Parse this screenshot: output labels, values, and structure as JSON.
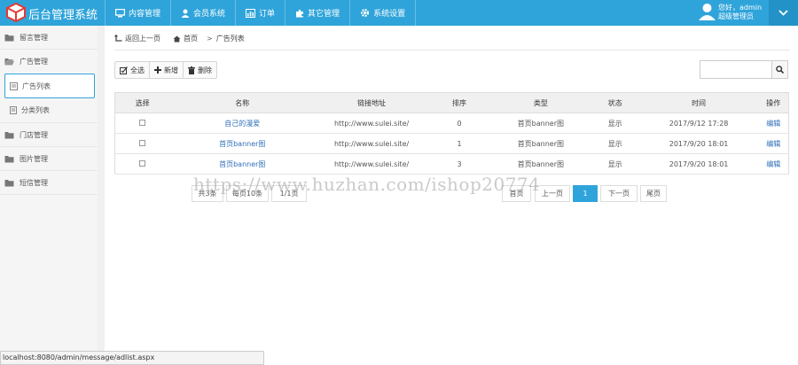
{
  "app": {
    "title": "后台管理系统"
  },
  "nav": [
    {
      "label": "内容管理",
      "icon": "monitor-icon"
    },
    {
      "label": "会员系统",
      "icon": "user-icon"
    },
    {
      "label": "订单",
      "icon": "chart-icon"
    },
    {
      "label": "其它管理",
      "icon": "puzzle-icon"
    },
    {
      "label": "系统设置",
      "icon": "gear-icon"
    }
  ],
  "user": {
    "greeting": "您好，admin",
    "role": "超级管理员"
  },
  "sidebar": {
    "groups": [
      {
        "label": "留言管理"
      },
      {
        "label": "广告管理"
      },
      {
        "label": "门店管理"
      },
      {
        "label": "图片管理"
      },
      {
        "label": "短信管理"
      }
    ],
    "subs": [
      {
        "label": "广告列表"
      },
      {
        "label": "分类列表"
      }
    ]
  },
  "breadcrumb": {
    "back": "返回上一页",
    "home": "首页",
    "sep": ">",
    "current": "广告列表"
  },
  "toolbar": {
    "select_all": "全选",
    "add": "新增",
    "delete": "删除"
  },
  "search": {
    "placeholder": ""
  },
  "table": {
    "headers": [
      "选择",
      "名称",
      "链接地址",
      "排序",
      "类型",
      "状态",
      "时间",
      "操作"
    ],
    "rows": [
      {
        "name": "自己的漫爱",
        "url": "http://www.sulei.site/",
        "sort": "0",
        "type": "首页banner图",
        "status": "显示",
        "time": "2017/9/12 17:28",
        "op": "编辑"
      },
      {
        "name": "首页banner图",
        "url": "http://www.sulei.site/",
        "sort": "1",
        "type": "首页banner图",
        "status": "显示",
        "time": "2017/9/20 18:01",
        "op": "编辑"
      },
      {
        "name": "首页banner图",
        "url": "http://www.sulei.site/",
        "sort": "3",
        "type": "首页banner图",
        "status": "显示",
        "time": "2017/9/20 18:01",
        "op": "编辑"
      }
    ]
  },
  "pagination": {
    "total": "共3条",
    "per_page": "每页10条",
    "pages": "1/1页",
    "first": "首页",
    "prev": "上一页",
    "current": "1",
    "next": "下一页",
    "last": "尾页"
  },
  "watermark": "https://www.huzhan.com/ishop20774",
  "statusbar": "localhost:8080/admin/message/adlist.aspx",
  "colors": {
    "accent": "#2fa4da",
    "link": "#2f6fb8"
  }
}
